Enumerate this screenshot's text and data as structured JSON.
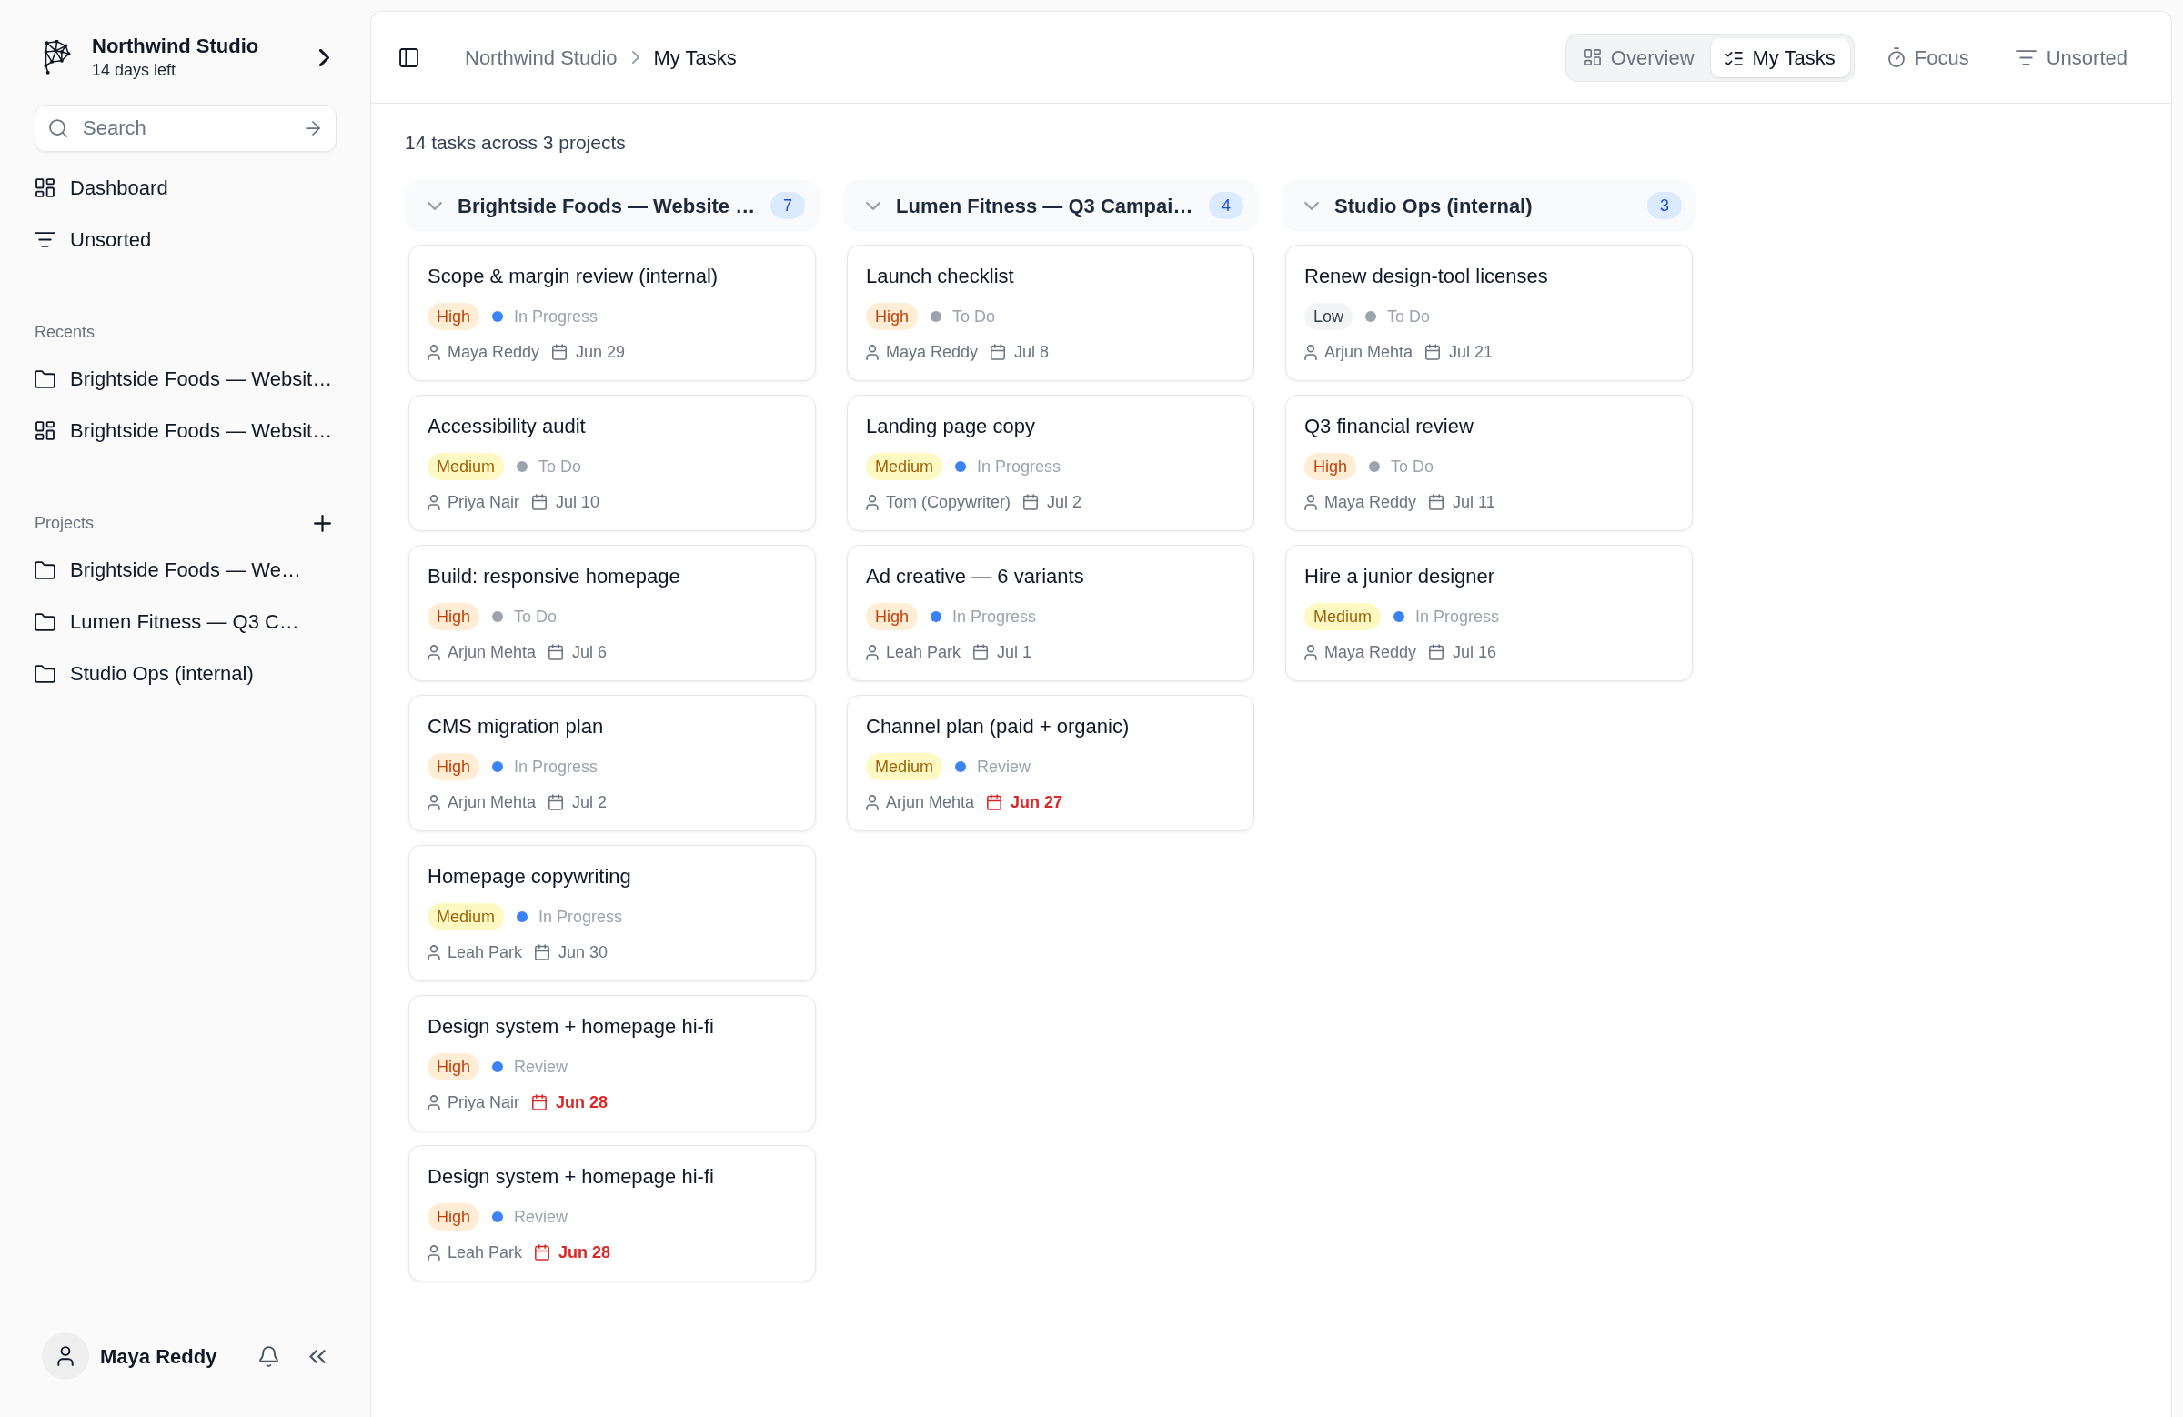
{
  "sidebar": {
    "workspace": {
      "name": "Northwind Studio",
      "subtitle": "14 days left"
    },
    "search": {
      "placeholder": "Search"
    },
    "nav": [
      {
        "label": "Dashboard",
        "kind": "dashboard"
      },
      {
        "label": "Unsorted",
        "kind": "filter"
      }
    ],
    "recents": {
      "title": "Recents",
      "items": [
        {
          "label": "Brightside Foods — Websit…",
          "kind": "folder"
        },
        {
          "label": "Brightside Foods — Websit…",
          "kind": "dashboard"
        }
      ]
    },
    "projects": {
      "title": "Projects",
      "items": [
        {
          "label": "Brightside Foods — We…",
          "kind": "folder"
        },
        {
          "label": "Lumen Fitness — Q3 C…",
          "kind": "folder"
        },
        {
          "label": "Studio Ops (internal)",
          "kind": "folder"
        }
      ]
    },
    "user": {
      "name": "Maya Reddy"
    }
  },
  "header": {
    "breadcrumb": [
      "Northwind Studio",
      "My Tasks"
    ],
    "views": [
      {
        "label": "Overview",
        "kind": "overview",
        "selected": false
      },
      {
        "label": "My Tasks",
        "kind": "tasks",
        "selected": true
      }
    ],
    "actions": [
      {
        "label": "Focus",
        "kind": "timer"
      },
      {
        "label": "Unsorted",
        "kind": "filter"
      }
    ]
  },
  "summary": "14 tasks across 3 projects",
  "columns": [
    {
      "title": "Brightside Foods — Website …",
      "count": "7",
      "expanded": true,
      "cards": [
        {
          "title": "Scope & margin review (internal)",
          "priority": {
            "label": "High",
            "kind": "high"
          },
          "status": {
            "label": "In Progress",
            "color": "#3b82f6"
          },
          "assignee": "Maya Reddy",
          "due": {
            "label": "Jun 29",
            "overdue": false
          }
        },
        {
          "title": "Accessibility audit",
          "priority": {
            "label": "Medium",
            "kind": "medium"
          },
          "status": {
            "label": "To Do",
            "color": "#9ca3af"
          },
          "assignee": "Priya Nair",
          "due": {
            "label": "Jul 10",
            "overdue": false
          }
        },
        {
          "title": "Build: responsive homepage",
          "priority": {
            "label": "High",
            "kind": "high"
          },
          "status": {
            "label": "To Do",
            "color": "#9ca3af"
          },
          "assignee": "Arjun Mehta",
          "due": {
            "label": "Jul 6",
            "overdue": false
          }
        },
        {
          "title": "CMS migration plan",
          "priority": {
            "label": "High",
            "kind": "high"
          },
          "status": {
            "label": "In Progress",
            "color": "#3b82f6"
          },
          "assignee": "Arjun Mehta",
          "due": {
            "label": "Jul 2",
            "overdue": false
          }
        },
        {
          "title": "Homepage copywriting",
          "priority": {
            "label": "Medium",
            "kind": "medium"
          },
          "status": {
            "label": "In Progress",
            "color": "#3b82f6"
          },
          "assignee": "Leah Park",
          "due": {
            "label": "Jun 30",
            "overdue": false
          }
        },
        {
          "title": "Design system + homepage hi-fi",
          "priority": {
            "label": "High",
            "kind": "high"
          },
          "status": {
            "label": "Review",
            "color": "#3b82f6"
          },
          "assignee": "Priya Nair",
          "due": {
            "label": "Jun 28",
            "overdue": true
          }
        },
        {
          "title": "Design system + homepage hi-fi",
          "priority": {
            "label": "High",
            "kind": "high"
          },
          "status": {
            "label": "Review",
            "color": "#3b82f6"
          },
          "assignee": "Leah Park",
          "due": {
            "label": "Jun 28",
            "overdue": true
          }
        }
      ]
    },
    {
      "title": "Lumen Fitness — Q3 Campai…",
      "count": "4",
      "expanded": true,
      "cards": [
        {
          "title": "Launch checklist",
          "priority": {
            "label": "High",
            "kind": "high"
          },
          "status": {
            "label": "To Do",
            "color": "#9ca3af"
          },
          "assignee": "Maya Reddy",
          "due": {
            "label": "Jul 8",
            "overdue": false
          }
        },
        {
          "title": "Landing page copy",
          "priority": {
            "label": "Medium",
            "kind": "medium"
          },
          "status": {
            "label": "In Progress",
            "color": "#3b82f6"
          },
          "assignee": "Tom (Copywriter)",
          "due": {
            "label": "Jul 2",
            "overdue": false
          }
        },
        {
          "title": "Ad creative — 6 variants",
          "priority": {
            "label": "High",
            "kind": "high"
          },
          "status": {
            "label": "In Progress",
            "color": "#3b82f6"
          },
          "assignee": "Leah Park",
          "due": {
            "label": "Jul 1",
            "overdue": false
          }
        },
        {
          "title": "Channel plan (paid + organic)",
          "priority": {
            "label": "Medium",
            "kind": "medium"
          },
          "status": {
            "label": "Review",
            "color": "#3b82f6"
          },
          "assignee": "Arjun Mehta",
          "due": {
            "label": "Jun 27",
            "overdue": true
          }
        }
      ]
    },
    {
      "title": "Studio Ops (internal)",
      "count": "3",
      "expanded": true,
      "cards": [
        {
          "title": "Renew design-tool licenses",
          "priority": {
            "label": "Low",
            "kind": "low"
          },
          "status": {
            "label": "To Do",
            "color": "#9ca3af"
          },
          "assignee": "Arjun Mehta",
          "due": {
            "label": "Jul 21",
            "overdue": false
          }
        },
        {
          "title": "Q3 financial review",
          "priority": {
            "label": "High",
            "kind": "high"
          },
          "status": {
            "label": "To Do",
            "color": "#9ca3af"
          },
          "assignee": "Maya Reddy",
          "due": {
            "label": "Jul 11",
            "overdue": false
          }
        },
        {
          "title": "Hire a junior designer",
          "priority": {
            "label": "Medium",
            "kind": "medium"
          },
          "status": {
            "label": "In Progress",
            "color": "#3b82f6"
          },
          "assignee": "Maya Reddy",
          "due": {
            "label": "Jul 16",
            "overdue": false
          }
        }
      ]
    }
  ]
}
